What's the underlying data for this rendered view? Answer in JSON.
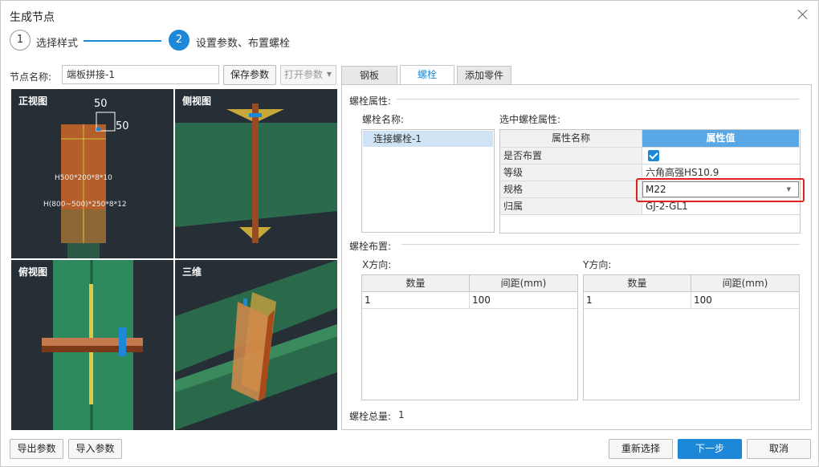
{
  "dialog": {
    "title": "生成节点"
  },
  "steps": [
    {
      "number": "1",
      "label": "选择样式"
    },
    {
      "number": "2",
      "label": "设置参数、布置螺栓"
    }
  ],
  "node": {
    "name_label": "节点名称:",
    "name_value": "端板拼接-1",
    "save_button": "保存参数",
    "open_button": "打开参数"
  },
  "views": {
    "front": {
      "title": "正视图",
      "dim_top": "50",
      "dim_right": "50",
      "label_1": "H500*200*8*10",
      "label_2": "H(800~500)*250*8*12"
    },
    "side": {
      "title": "侧视图"
    },
    "top": {
      "title": "俯视图"
    },
    "three_d": {
      "title": "三维"
    }
  },
  "tabs": [
    {
      "label": "钢板",
      "active": false
    },
    {
      "label": "螺栓",
      "active": true
    },
    {
      "label": "添加零件",
      "active": false
    }
  ],
  "bolt_props": {
    "section_label": "螺栓属性:",
    "name_list_label": "螺栓名称:",
    "names": [
      "连接螺栓-1"
    ],
    "selected_label": "选中螺栓属性:",
    "header_name": "属性名称",
    "header_value": "属性值",
    "rows": [
      {
        "name": "是否布置",
        "value": "",
        "checked": true
      },
      {
        "name": "等级",
        "value": "六角高强HS10.9"
      },
      {
        "name": "规格",
        "value": "M22"
      },
      {
        "name": "归属",
        "value": "GJ-2-GL1"
      }
    ]
  },
  "bolt_layout": {
    "section_label": "螺栓布置:",
    "x_label": "X方向:",
    "y_label": "Y方向:",
    "col_count": "数量",
    "col_spacing": "间距(mm)",
    "x_rows": [
      {
        "count": "1",
        "spacing": "100"
      }
    ],
    "y_rows": [
      {
        "count": "1",
        "spacing": "100"
      }
    ],
    "total_label": "螺栓总量:",
    "total_value": "1"
  },
  "footer": {
    "export_button": "导出参数",
    "import_button": "导入参数",
    "reselect_button": "重新选择",
    "next_button": "下一步",
    "cancel_button": "取消"
  },
  "colors": {
    "accent": "#1e88d8",
    "highlight_box": "#e02020",
    "view_bg": "#262f36",
    "member_green": "#2e8a5e",
    "plate_orange": "#c8702e"
  }
}
